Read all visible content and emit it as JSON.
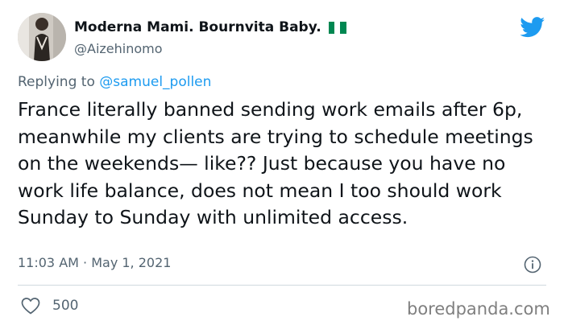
{
  "tweet": {
    "display_name": "Moderna Mami. Bournvita Baby.",
    "flag_emoji": "nigeria-flag",
    "handle": "@Aizehinomo",
    "reply_prefix": "Replying to",
    "reply_to": "@samuel_pollen",
    "text": "France literally banned sending work emails after 6p, meanwhile my clients are trying to schedule meetings on the weekends— like?? Just because you have no work life balance, does not mean I too should work Sunday to Sunday with unlimited access.",
    "timestamp": "11:03 AM · May 1, 2021",
    "like_count": "500"
  },
  "watermark": "boredpanda.com",
  "colors": {
    "twitter_blue": "#1d9bf0",
    "flag_green": "#008751",
    "text_primary": "#0f1419",
    "text_secondary": "#536471"
  },
  "icons": {
    "brand": "twitter-bird-icon",
    "info": "info-icon",
    "like": "heart-icon"
  }
}
